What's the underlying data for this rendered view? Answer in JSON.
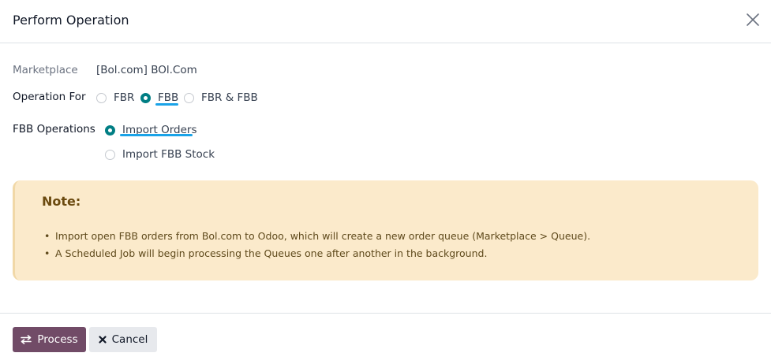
{
  "dialog": {
    "title": "Perform Operation"
  },
  "form": {
    "marketplace": {
      "label": "Marketplace",
      "value": "[Bol.com] BOl.Com"
    },
    "operation_for": {
      "label": "Operation For",
      "options": [
        {
          "label": "FBR",
          "checked": false
        },
        {
          "label": "FBB",
          "checked": true
        },
        {
          "label": "FBR & FBB",
          "checked": false
        }
      ]
    },
    "fbb_operations": {
      "label": "FBB Operations",
      "options": [
        {
          "label": "Import Orders",
          "checked": true
        },
        {
          "label": "Import FBB Stock",
          "checked": false
        }
      ]
    }
  },
  "note": {
    "title": "Note:",
    "items": [
      "Import open FBB orders from Bol.com to Odoo, which will create a new order queue (Marketplace > Queue).",
      "A Scheduled Job will begin processing the Queues one after another in the background."
    ]
  },
  "footer": {
    "process_label": "Process",
    "cancel_label": "Cancel"
  },
  "colors": {
    "primary": "#714b67",
    "radio_checked": "#017e84",
    "annotation_underline": "#1aa3e8",
    "note_background": "#fbeacb"
  },
  "icons": {
    "close": "close-icon",
    "process": "exchange-arrows-icon",
    "cancel": "x-mark-icon"
  }
}
